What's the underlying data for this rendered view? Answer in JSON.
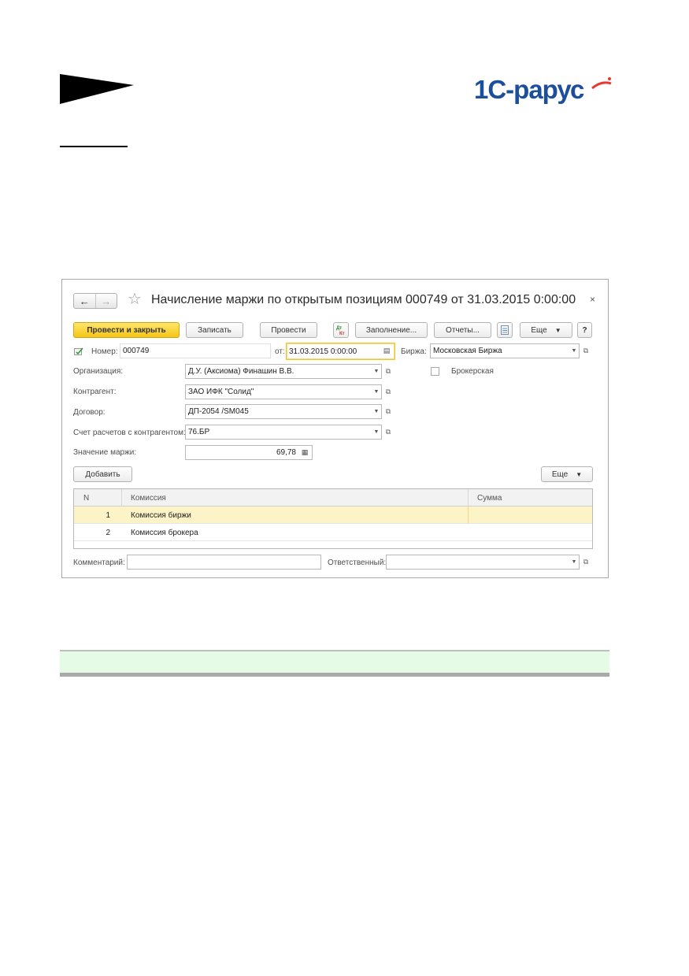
{
  "window": {
    "title": "Начисление маржи по открытым позициям 000749 от 31.03.2015 0:00:00",
    "nav": {
      "back": "←",
      "forward": "→"
    },
    "favorite_icon": "star-icon",
    "close": "×"
  },
  "toolbar": {
    "post_close": "Провести и закрыть",
    "save": "Записать",
    "post": "Провести",
    "dt_kt": "Дт Кт",
    "fill": "Заполнение...",
    "reports": "Отчеты...",
    "more": "Еще",
    "help": "?"
  },
  "header": {
    "number_label": "Номер:",
    "number_value": "000749",
    "date_label": "от:",
    "date_value": "31.03.2015  0:00:00",
    "exchange_label": "Биржа:",
    "exchange_value": "Московская Биржа",
    "broker_label": "Брокерская"
  },
  "form": {
    "org_label": "Организация:",
    "org_value": "Д.У. (Аксиома) Финашин В.В.",
    "counterparty_label": "Контрагент:",
    "counterparty_value": "ЗАО ИФК \"Солид\"",
    "contract_label": "Договор:",
    "contract_value": "ДП-2054 /SM045",
    "account_label": "Счет расчетов с контрагентом:",
    "account_value": "76.БР",
    "margin_label": "Значение маржи:",
    "margin_value": "69,78"
  },
  "table_toolbar": {
    "add": "Добавить",
    "more": "Еще"
  },
  "table": {
    "columns": [
      "N",
      "Комиссия",
      "Сумма"
    ],
    "rows": [
      {
        "n": "1",
        "commission": "Комиссия биржи",
        "sum": ""
      },
      {
        "n": "2",
        "commission": "Комиссия брокера",
        "sum": ""
      }
    ]
  },
  "footer": {
    "comment_label": "Комментарий:",
    "comment_value": "",
    "responsible_label": "Ответственный:",
    "responsible_value": ""
  },
  "logo": {
    "text": "1С-РАРУС"
  }
}
